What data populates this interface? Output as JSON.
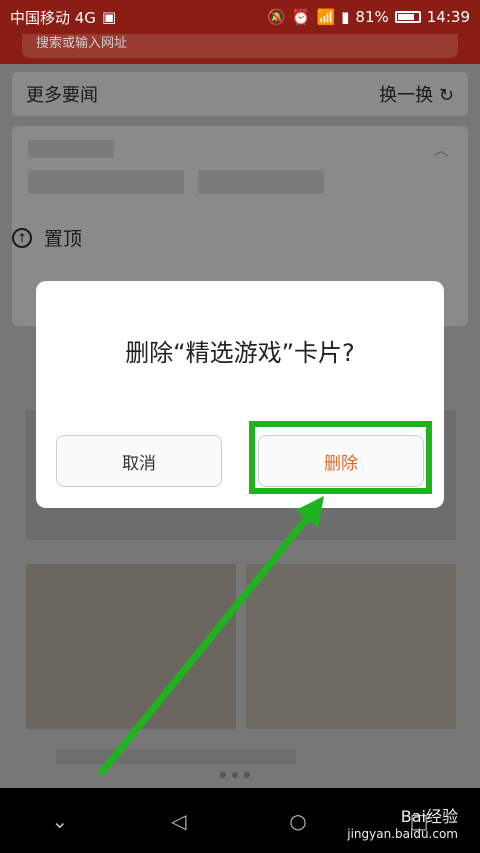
{
  "status_bar": {
    "carrier": "中国移动 4G",
    "battery": "81%",
    "time": "14:39",
    "battery_level": 0.81
  },
  "search": {
    "placeholder": "搜索或输入网址"
  },
  "news_head": {
    "title": "更多要闻",
    "refresh_label": "换一换"
  },
  "card": {
    "pin_label": "置顶"
  },
  "dialog": {
    "title": "删除“精选游戏”卡片?",
    "cancel_label": "取消",
    "delete_label": "删除"
  },
  "watermark": {
    "brand": "Bai经验",
    "url": "jingyan.baidu.com"
  },
  "colors": {
    "highlight": "#1fb31f",
    "delete_text": "#e06a2c",
    "status_bar": "#8b1e14"
  }
}
